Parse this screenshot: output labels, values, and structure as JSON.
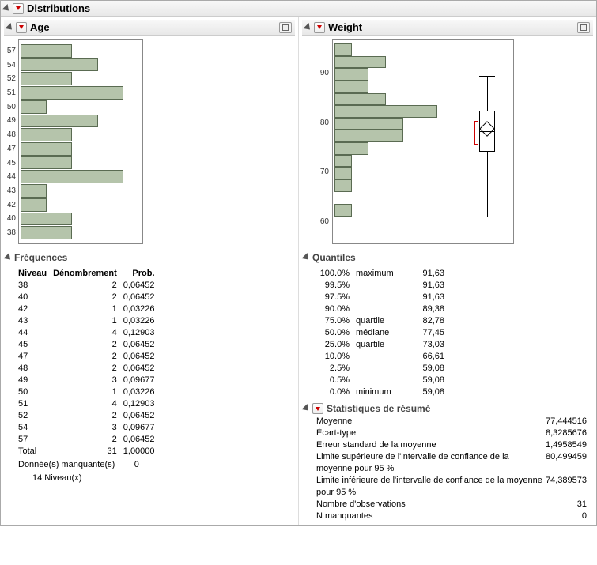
{
  "title": "Distributions",
  "age": {
    "title": "Age",
    "freq_title": "Fréquences",
    "headers": {
      "niveau": "Niveau",
      "den": "Dénombrement",
      "prob": "Prob."
    },
    "rows": [
      {
        "niveau": "38",
        "count": 2,
        "prob": "0,06452"
      },
      {
        "niveau": "40",
        "count": 2,
        "prob": "0,06452"
      },
      {
        "niveau": "42",
        "count": 1,
        "prob": "0,03226"
      },
      {
        "niveau": "43",
        "count": 1,
        "prob": "0,03226"
      },
      {
        "niveau": "44",
        "count": 4,
        "prob": "0,12903"
      },
      {
        "niveau": "45",
        "count": 2,
        "prob": "0,06452"
      },
      {
        "niveau": "47",
        "count": 2,
        "prob": "0,06452"
      },
      {
        "niveau": "48",
        "count": 2,
        "prob": "0,06452"
      },
      {
        "niveau": "49",
        "count": 3,
        "prob": "0,09677"
      },
      {
        "niveau": "50",
        "count": 1,
        "prob": "0,03226"
      },
      {
        "niveau": "51",
        "count": 4,
        "prob": "0,12903"
      },
      {
        "niveau": "52",
        "count": 2,
        "prob": "0,06452"
      },
      {
        "niveau": "54",
        "count": 3,
        "prob": "0,09677"
      },
      {
        "niveau": "57",
        "count": 2,
        "prob": "0,06452"
      }
    ],
    "total_label": "Total",
    "total_count": 31,
    "total_prob": "1,00000",
    "missing_label": "Donnée(s) manquante(s)",
    "missing": 0,
    "levels_label": "14  Niveau(x)",
    "chart_labels": [
      "57",
      "54",
      "52",
      "51",
      "50",
      "49",
      "48",
      "47",
      "45",
      "44",
      "43",
      "42",
      "40",
      "38"
    ]
  },
  "weight": {
    "title": "Weight",
    "quant_title": "Quantiles",
    "quant_rows": [
      {
        "p": "100.0%",
        "lab": "maximum",
        "v": "91,63"
      },
      {
        "p": "99.5%",
        "lab": "",
        "v": "91,63"
      },
      {
        "p": "97.5%",
        "lab": "",
        "v": "91,63"
      },
      {
        "p": "90.0%",
        "lab": "",
        "v": "89,38"
      },
      {
        "p": "75.0%",
        "lab": "quartile",
        "v": "82,78"
      },
      {
        "p": "50.0%",
        "lab": "médiane",
        "v": "77,45"
      },
      {
        "p": "25.0%",
        "lab": "quartile",
        "v": "73,03"
      },
      {
        "p": "10.0%",
        "lab": "",
        "v": "66,61"
      },
      {
        "p": "2.5%",
        "lab": "",
        "v": "59,08"
      },
      {
        "p": "0.5%",
        "lab": "",
        "v": "59,08"
      },
      {
        "p": "0.0%",
        "lab": "minimum",
        "v": "59,08"
      }
    ],
    "stats_title": "Statistiques de résumé",
    "stats": [
      {
        "k": "Moyenne",
        "v": "77,444516"
      },
      {
        "k": "Écart-type",
        "v": "8,3285676"
      },
      {
        "k": "Erreur standard de la moyenne",
        "v": "1,4958549"
      },
      {
        "k": "Limite supérieure de l'intervalle de confiance de la moyenne pour 95 %",
        "v": "80,499459"
      },
      {
        "k": "Limite inférieure de l'intervalle de confiance de la moyenne pour 95 %",
        "v": "74,389573"
      },
      {
        "k": "Nombre d'observations",
        "v": "31"
      },
      {
        "k": "N manquantes",
        "v": "0"
      }
    ],
    "chart_ticks": [
      "90",
      "80",
      "70",
      "60"
    ],
    "hist_bins": [
      {
        "y": 92.5,
        "c": 1
      },
      {
        "y": 90,
        "c": 3
      },
      {
        "y": 87.5,
        "c": 2
      },
      {
        "y": 85,
        "c": 2
      },
      {
        "y": 82.5,
        "c": 3
      },
      {
        "y": 80,
        "c": 6
      },
      {
        "y": 77.5,
        "c": 4
      },
      {
        "y": 75,
        "c": 4
      },
      {
        "y": 72.5,
        "c": 2
      },
      {
        "y": 70,
        "c": 1
      },
      {
        "y": 67.5,
        "c": 1
      },
      {
        "y": 65,
        "c": 1
      },
      {
        "y": 60,
        "c": 1
      }
    ]
  },
  "chart_data": [
    {
      "type": "bar",
      "orientation": "horizontal",
      "title": "Age",
      "categories": [
        "38",
        "40",
        "42",
        "43",
        "44",
        "45",
        "47",
        "48",
        "49",
        "50",
        "51",
        "52",
        "54",
        "57"
      ],
      "values": [
        2,
        2,
        1,
        1,
        4,
        2,
        2,
        2,
        3,
        1,
        4,
        2,
        3,
        2
      ]
    },
    {
      "type": "bar",
      "orientation": "horizontal",
      "title": "Weight histogram",
      "ylabel": "Weight",
      "bins": [
        57.5,
        60,
        62.5,
        65,
        67.5,
        70,
        72.5,
        75,
        77.5,
        80,
        82.5,
        85,
        87.5,
        90,
        92.5,
        95
      ],
      "counts": [
        0,
        1,
        0,
        1,
        1,
        1,
        2,
        4,
        4,
        6,
        3,
        2,
        2,
        3,
        1
      ],
      "ylim": [
        55,
        95
      ]
    }
  ]
}
